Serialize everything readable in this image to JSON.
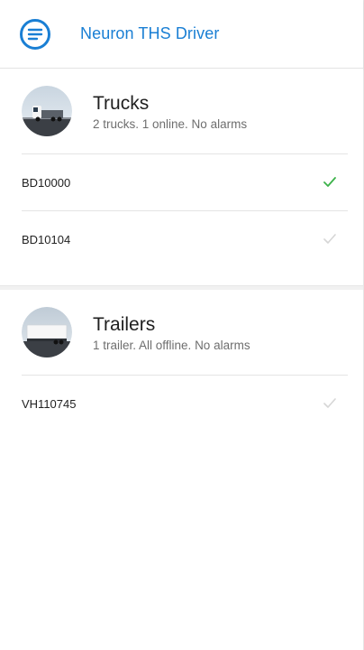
{
  "header": {
    "title": "Neuron THS Driver",
    "menu_icon": "menu-circle-icon",
    "accent": "#1a7fd4"
  },
  "trucks": {
    "title": "Trucks",
    "subtitle": "2 trucks. 1 online. No alarms",
    "avatar_icon": "truck-avatar-icon",
    "items": [
      {
        "label": "BD10000",
        "status": "online",
        "check_color": "#3cb24a"
      },
      {
        "label": "BD10104",
        "status": "offline",
        "check_color": "#d6d6d6"
      }
    ]
  },
  "trailers": {
    "title": "Trailers",
    "subtitle": "1 trailer. All offline. No alarms",
    "avatar_icon": "trailer-avatar-icon",
    "items": [
      {
        "label": "VH110745",
        "status": "offline",
        "check_color": "#d6d6d6"
      }
    ]
  }
}
